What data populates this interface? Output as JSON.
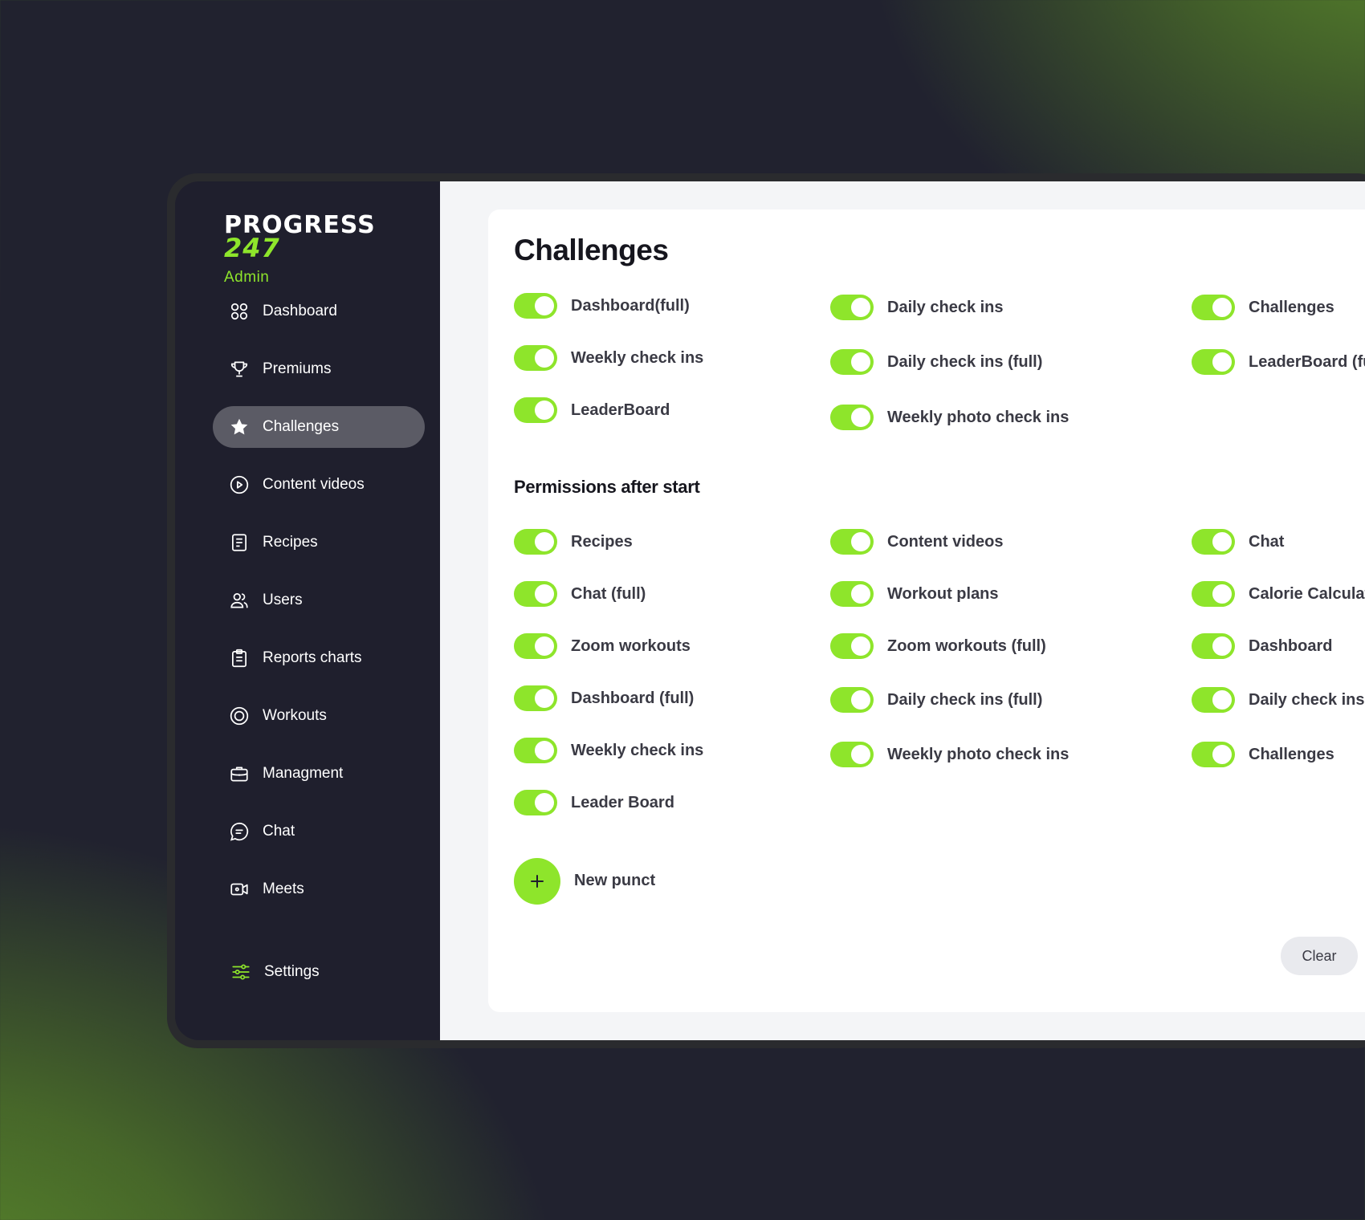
{
  "brand": {
    "line1": "PROGRESS",
    "line2": "247",
    "role": "Admin"
  },
  "sidebar": {
    "items": [
      {
        "label": "Dashboard",
        "icon": "dashboard-icon"
      },
      {
        "label": "Premiums",
        "icon": "trophy-icon"
      },
      {
        "label": "Challenges",
        "icon": "star-icon",
        "active": true
      },
      {
        "label": "Content videos",
        "icon": "play-circle-icon"
      },
      {
        "label": "Recipes",
        "icon": "document-icon"
      },
      {
        "label": "Users",
        "icon": "users-icon"
      },
      {
        "label": "Reports charts",
        "icon": "clipboard-icon"
      },
      {
        "label": "Workouts",
        "icon": "target-icon"
      },
      {
        "label": "Managment",
        "icon": "briefcase-icon"
      },
      {
        "label": "Chat",
        "icon": "chat-icon"
      },
      {
        "label": "Meets",
        "icon": "video-icon"
      }
    ],
    "settings": {
      "label": "Settings",
      "icon": "sliders-icon"
    }
  },
  "main": {
    "title": "Challenges",
    "permissions": [
      [
        "Dashboard(full)",
        "Weekly check ins",
        "LeaderBoard"
      ],
      [
        "Daily check ins",
        "Daily check ins (full)",
        "Weekly photo check ins"
      ],
      [
        "Challenges",
        "LeaderBoard (full)"
      ]
    ],
    "section_title": "Permissions after start",
    "after_start": [
      [
        "Recipes",
        "Chat (full)",
        "Zoom workouts",
        "Dashboard (full)",
        "Weekly check ins",
        "Leader Board"
      ],
      [
        "Content videos",
        "Workout plans",
        "Zoom workouts (full)",
        "Daily check ins (full)",
        "Weekly photo check ins"
      ],
      [
        "Chat",
        "Calorie Calculator",
        "Dashboard",
        "Daily check ins (full)",
        "Challenges"
      ]
    ],
    "toggle_state": "on",
    "accent_color": "#8ee52b",
    "new_label": "New punct",
    "clear_label": "Clear"
  }
}
